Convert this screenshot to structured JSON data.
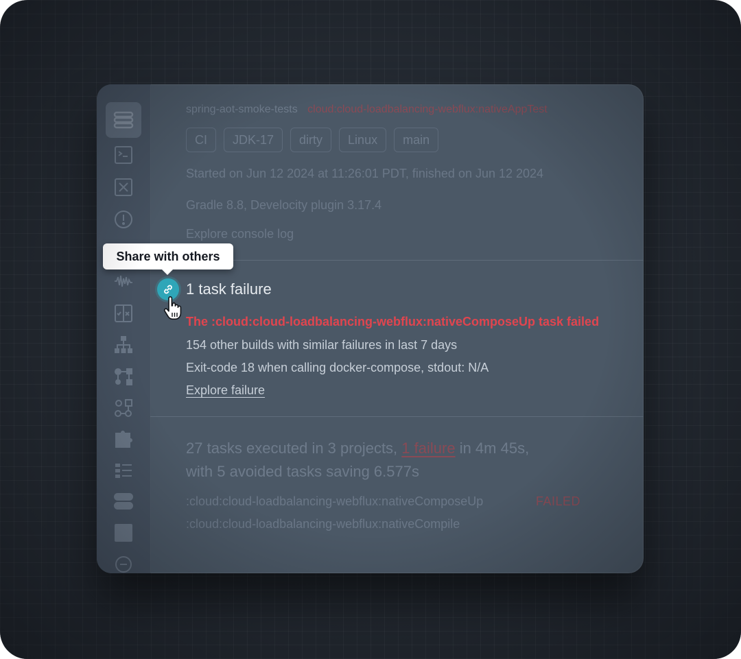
{
  "header": {
    "project": "spring-aot-smoke-tests",
    "target": "cloud:cloud-loadbalancing-webflux:nativeAppTest",
    "tags": [
      "CI",
      "JDK-17",
      "dirty",
      "Linux",
      "main"
    ],
    "started": "Started on Jun 12 2024 at 11:26:01 PDT, finished on Jun 12 2024",
    "gradle": "Gradle 8.8, Develocity plugin 3.17.4",
    "console_link": "Explore console log"
  },
  "tooltip": {
    "text": "Share with others"
  },
  "failure": {
    "title": "1 task failure",
    "task_failed": "The :cloud:cloud-loadbalancing-webflux:nativeComposeUp task failed",
    "similar": "154 other builds with similar failures in last 7 days",
    "exit": "Exit-code 18 when calling docker-compose, stdout: N/A",
    "explore": "Explore failure"
  },
  "summary": {
    "part1": "27 tasks executed in 3 projects, ",
    "failure_link": "1 failure",
    "part2": " in 4m 45s,",
    "line2": "with 5 avoided tasks saving 6.577s"
  },
  "tasks": [
    {
      "name": ":cloud:cloud-loadbalancing-webflux:nativeComposeUp",
      "status": "FAILED"
    },
    {
      "name": ":cloud:cloud-loadbalancing-webflux:nativeCompile",
      "status": ""
    }
  ],
  "sidebar": {
    "icons": [
      "list-icon",
      "console-icon",
      "close-box-icon",
      "warning-circle-icon",
      "waveform-icon",
      "tests-icon",
      "hierarchy-icon",
      "flow-icon",
      "build-graph-icon",
      "plugin-icon",
      "details-list-icon",
      "toggle-icon",
      "square-icon",
      "minus-circle-icon"
    ]
  },
  "colors": {
    "accent": "#2fa6b8",
    "error": "#e0454f"
  }
}
